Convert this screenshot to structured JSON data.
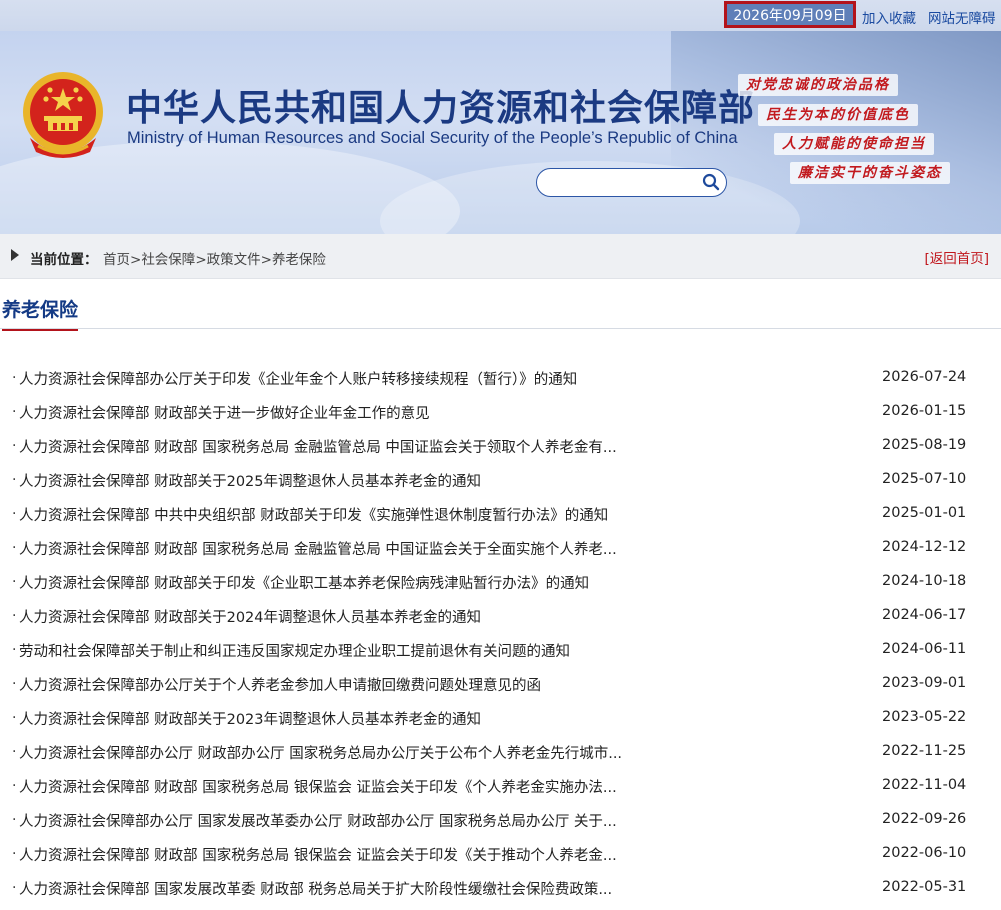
{
  "topbar": {
    "date": "2026年09月09日",
    "links": [
      "加入收藏",
      "网站无障碍"
    ]
  },
  "header": {
    "title_cn": "中华人民共和国人力资源和社会保障部",
    "title_en": "Ministry of Human Resources and Social Security of the People’s Republic of China",
    "search_placeholder": "",
    "slogans": [
      "对党忠诚的政治品格",
      "民生为本的价值底色",
      "人力赋能的使命担当",
      "廉洁实干的奋斗姿态"
    ]
  },
  "breadcrumb": {
    "label": "当前位置：",
    "items": [
      "首页",
      "社会保障",
      "政策文件",
      "养老保险"
    ],
    "separator": ">",
    "back_home": "[返回首页]"
  },
  "section": {
    "title": "养老保险"
  },
  "articles": [
    {
      "title": "人力资源社会保障部办公厅关于印发《企业年金个人账户转移接续规程（暂行）》的通知",
      "date": "2026-07-24"
    },
    {
      "title": "人力资源社会保障部 财政部关于进一步做好企业年金工作的意见",
      "date": "2026-01-15"
    },
    {
      "title": "人力资源社会保障部 财政部 国家税务总局 金融监管总局 中国证监会关于领取个人养老金有...",
      "date": "2025-08-19"
    },
    {
      "title": "人力资源社会保障部 财政部关于2025年调整退休人员基本养老金的通知",
      "date": "2025-07-10"
    },
    {
      "title": "人力资源社会保障部 中共中央组织部 财政部关于印发《实施弹性退休制度暂行办法》的通知",
      "date": "2025-01-01"
    },
    {
      "title": "人力资源社会保障部 财政部 国家税务总局 金融监管总局 中国证监会关于全面实施个人养老...",
      "date": "2024-12-12"
    },
    {
      "title": "人力资源社会保障部 财政部关于印发《企业职工基本养老保险病残津贴暂行办法》的通知",
      "date": "2024-10-18"
    },
    {
      "title": "人力资源社会保障部 财政部关于2024年调整退休人员基本养老金的通知",
      "date": "2024-06-17"
    },
    {
      "title": "劳动和社会保障部关于制止和纠正违反国家规定办理企业职工提前退休有关问题的通知",
      "date": "2024-06-11"
    },
    {
      "title": "人力资源社会保障部办公厅关于个人养老金参加人申请撤回缴费问题处理意见的函",
      "date": "2023-09-01"
    },
    {
      "title": "人力资源社会保障部 财政部关于2023年调整退休人员基本养老金的通知",
      "date": "2023-05-22"
    },
    {
      "title": "人力资源社会保障部办公厅 财政部办公厅 国家税务总局办公厅关于公布个人养老金先行城市...",
      "date": "2022-11-25"
    },
    {
      "title": "人力资源社会保障部 财政部 国家税务总局 银保监会 证监会关于印发《个人养老金实施办法...",
      "date": "2022-11-04"
    },
    {
      "title": "人力资源社会保障部办公厅 国家发展改革委办公厅 财政部办公厅 国家税务总局办公厅 关于...",
      "date": "2022-09-26"
    },
    {
      "title": "人力资源社会保障部 财政部 国家税务总局 银保监会 证监会关于印发《关于推动个人养老金...",
      "date": "2022-06-10"
    },
    {
      "title": "人力资源社会保障部 国家发展改革委 财政部 税务总局关于扩大阶段性缓缴社会保险费政策...",
      "date": "2022-05-31"
    }
  ],
  "colors": {
    "brand_blue": "#1b3a82",
    "accent_red": "#b3131b",
    "link_blue": "#1a4aa0"
  }
}
